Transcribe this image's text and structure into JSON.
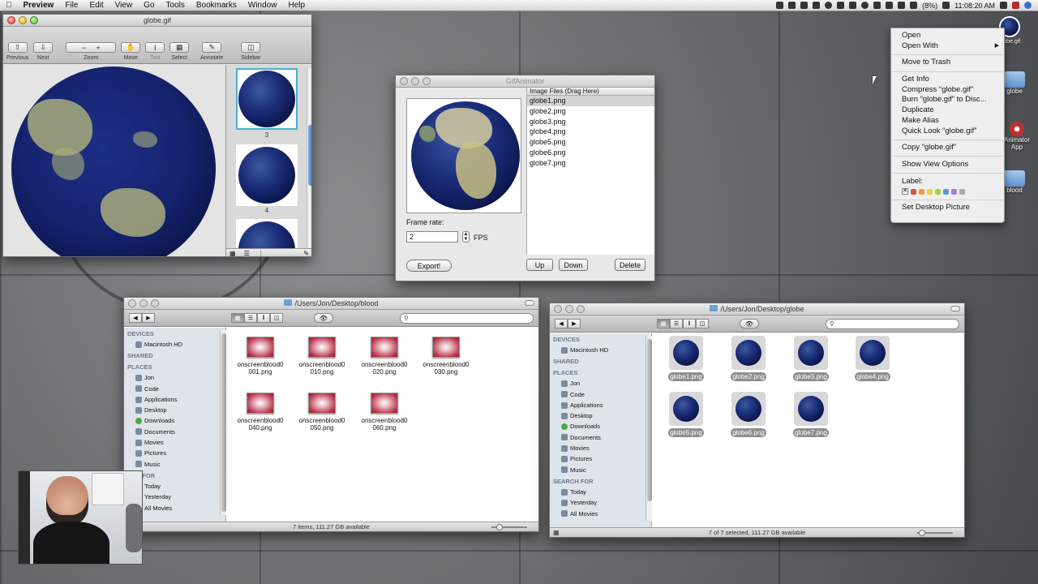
{
  "menubar": {
    "apple": "",
    "app_name": "Preview",
    "menus": [
      "File",
      "Edit",
      "View",
      "Go",
      "Tools",
      "Bookmarks",
      "Window",
      "Help"
    ],
    "battery": "(8%)",
    "clock": "11:08:20 AM"
  },
  "preview": {
    "title": "globe.gif",
    "toolbar": [
      {
        "label": "Previous"
      },
      {
        "label": "Next"
      },
      {
        "label": "Zoom"
      },
      {
        "label": "Move"
      },
      {
        "label": "Text"
      },
      {
        "label": "Select"
      },
      {
        "label": "Annotate"
      },
      {
        "label": "Sidebar"
      }
    ],
    "thumb_labels": [
      "3",
      "4"
    ]
  },
  "gif_animator": {
    "title": "GifAnimator",
    "list_header": "Image Files (Drag Here)",
    "files": [
      "globe1.png",
      "globe2.png",
      "globe3.png",
      "globe4.png",
      "globe5.png",
      "globe6.png",
      "globe7.png"
    ],
    "frame_rate_label": "Frame rate:",
    "frame_rate_value": "2",
    "fps_label": "FPS",
    "export_button": "Export!",
    "up_button": "Up",
    "down_button": "Down",
    "delete_button": "Delete"
  },
  "context_menu": {
    "items": [
      "Open",
      "Open With",
      "Move to Trash",
      "Get Info",
      "Compress “globe.gif”",
      "Burn “globe.gif” to Disc...",
      "Duplicate",
      "Make Alias",
      "Quick Look “globe.gif”",
      "Copy “globe.gif”",
      "Show View Options",
      "Label:",
      "Set Desktop Picture"
    ],
    "label_colors": [
      "#e05050",
      "#f09a3a",
      "#f0d040",
      "#9bd24a",
      "#5a9ae0",
      "#b07ad8",
      "#aaaaaa"
    ]
  },
  "desktop": {
    "icons": [
      "globe.gif",
      "globe",
      "Animator",
      "App",
      "blood"
    ]
  },
  "finder_blood": {
    "path": "/Users/Jon/Desktop/blood",
    "status": "7 items, 111.27 GB available",
    "files": [
      [
        "onscreenblood0",
        "001.png"
      ],
      [
        "onscreenblood0",
        "010.png"
      ],
      [
        "onscreenblood0",
        "020.png"
      ],
      [
        "onscreenblood0",
        "030.png"
      ],
      [
        "onscreenblood0",
        "040.png"
      ],
      [
        "onscreenblood0",
        "050.png"
      ],
      [
        "onscreenblood0",
        "060.png"
      ]
    ],
    "sidebar": {
      "devices": "DEVICES",
      "device_items": [
        "Macintosh HD"
      ],
      "shared": "SHARED",
      "places": "PLACES",
      "place_items": [
        "Jon",
        "Code",
        "Applications",
        "Desktop",
        "Downloads",
        "Documents",
        "Movies",
        "Pictures",
        "Music"
      ],
      "search": "RCH FOR",
      "search_items": [
        "Today",
        "Yesterday",
        "All Movies"
      ]
    }
  },
  "finder_globe": {
    "path": "/Users/Jon/Desktop/globe",
    "status": "7 of 7 selected, 111.27 GB available",
    "files": [
      "globe1.png",
      "globe2.png",
      "globe3.png",
      "globe4.png",
      "globe5.png",
      "globe6.png",
      "globe7.png"
    ],
    "sidebar": {
      "devices": "DEVICES",
      "device_items": [
        "Macintosh HD"
      ],
      "shared": "SHARED",
      "places": "PLACES",
      "place_items": [
        "Jon",
        "Code",
        "Applications",
        "Desktop",
        "Downloads",
        "Documents",
        "Movies",
        "Pictures",
        "Music"
      ],
      "search": "SEARCH FOR",
      "search_items": [
        "Today",
        "Yesterday",
        "All Movies"
      ]
    }
  }
}
